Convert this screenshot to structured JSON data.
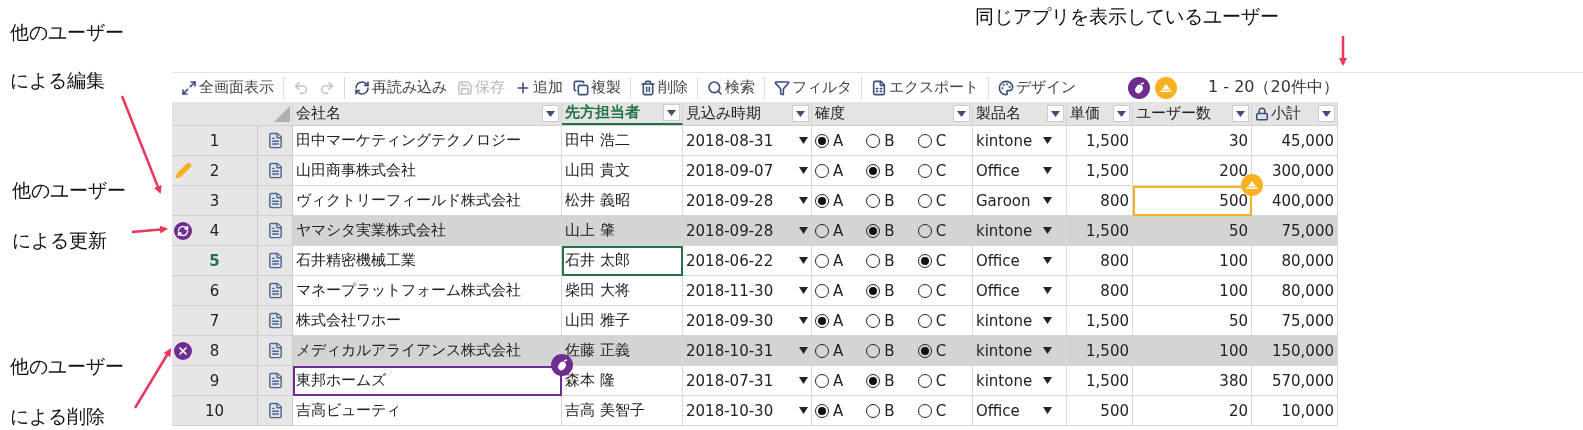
{
  "annotations": [
    {
      "lines": [
        "同じアプリを表示しているユーザー"
      ]
    },
    {
      "lines": [
        "他のユーザー",
        "による編集"
      ]
    },
    {
      "lines": [
        "他のユーザー",
        "による更新"
      ]
    },
    {
      "lines": [
        "他のユーザー",
        "による削除"
      ]
    }
  ],
  "toolbar": {
    "groups": [
      [
        {
          "kind": "fullscreen",
          "label": "全画面表示",
          "disabled": false
        }
      ],
      [
        {
          "kind": "undo",
          "disabled": true
        },
        {
          "kind": "redo",
          "disabled": true
        }
      ],
      [
        {
          "kind": "reload",
          "label": "再読み込み",
          "disabled": false
        },
        {
          "kind": "save",
          "label": "保存",
          "disabled": true
        },
        {
          "kind": "add",
          "label": "追加",
          "disabled": false
        },
        {
          "kind": "copy",
          "label": "複製",
          "disabled": false
        }
      ],
      [
        {
          "kind": "delete",
          "label": "削除",
          "disabled": false
        }
      ],
      [
        {
          "kind": "search",
          "label": "検索",
          "disabled": false
        }
      ],
      [
        {
          "kind": "filter",
          "label": "フィルタ",
          "disabled": false
        }
      ],
      [
        {
          "kind": "export",
          "label": "エクスポート",
          "disabled": false
        }
      ],
      [
        {
          "kind": "design",
          "label": "デザイン",
          "disabled": false
        }
      ]
    ],
    "viewers": [
      {
        "color": "#6f2c91"
      },
      {
        "color": "#f6b21f"
      }
    ],
    "pagination": "1 - 20（20件中）"
  },
  "columns": [
    {
      "label": "会社名",
      "selected": false,
      "locked": false
    },
    {
      "label": "先方担当者",
      "selected": true,
      "locked": false
    },
    {
      "label": "見込み時期",
      "selected": false,
      "locked": false
    },
    {
      "label": "確度",
      "selected": false,
      "locked": false
    },
    {
      "label": "製品名",
      "selected": false,
      "locked": false
    },
    {
      "label": "単価",
      "selected": false,
      "locked": false
    },
    {
      "label": "ユーザー数",
      "selected": false,
      "locked": false
    },
    {
      "label": "小計",
      "selected": false,
      "locked": true
    }
  ],
  "rows": [
    {
      "number": "1",
      "kind": "none",
      "selected": false,
      "company": "田中マーケティングテクノロジー",
      "contact": "田中 浩二",
      "date": "2018-08-31",
      "certainty": [
        {
          "label": "A",
          "selected": true
        },
        {
          "label": "B",
          "selected": false
        },
        {
          "label": "C",
          "selected": false
        }
      ],
      "product": "kintone",
      "price": "1,500",
      "users": "30",
      "subtotal": "45,000"
    },
    {
      "number": "2",
      "kind": "edited",
      "selected": false,
      "company": "山田商事株式会社",
      "contact": "山田 貴文",
      "date": "2018-09-07",
      "certainty": [
        {
          "label": "A",
          "selected": false
        },
        {
          "label": "B",
          "selected": true
        },
        {
          "label": "C",
          "selected": false
        }
      ],
      "product": "Office",
      "price": "1,500",
      "users": "200",
      "subtotal": "300,000"
    },
    {
      "number": "3",
      "kind": "none",
      "selected": false,
      "company": "ヴィクトリーフィールド株式会社",
      "contact": "松井 義昭",
      "date": "2018-09-28",
      "certainty": [
        {
          "label": "A",
          "selected": true
        },
        {
          "label": "B",
          "selected": false
        },
        {
          "label": "C",
          "selected": false
        }
      ],
      "product": "Garoon",
      "price": "800",
      "users": "500",
      "users_cursor": {
        "color": "#f6b21f"
      },
      "subtotal": "400,000"
    },
    {
      "number": "4",
      "kind": "updated",
      "selected": false,
      "company": "ヤマシタ実業株式会社",
      "contact": "山上 肇",
      "date": "2018-09-28",
      "certainty": [
        {
          "label": "A",
          "selected": false
        },
        {
          "label": "B",
          "selected": true
        },
        {
          "label": "C",
          "selected": false
        }
      ],
      "product": "kintone",
      "price": "1,500",
      "users": "50",
      "subtotal": "75,000"
    },
    {
      "number": "5",
      "kind": "none",
      "selected": true,
      "company": "石井精密機械工業",
      "contact": "石井 太郎",
      "date": "2018-06-22",
      "certainty": [
        {
          "label": "A",
          "selected": false
        },
        {
          "label": "B",
          "selected": false
        },
        {
          "label": "C",
          "selected": true
        }
      ],
      "product": "Office",
      "price": "800",
      "users": "100",
      "subtotal": "80,000"
    },
    {
      "number": "6",
      "kind": "none",
      "selected": false,
      "company": "マネープラットフォーム株式会社",
      "contact": "柴田 大将",
      "date": "2018-11-30",
      "certainty": [
        {
          "label": "A",
          "selected": false
        },
        {
          "label": "B",
          "selected": true
        },
        {
          "label": "C",
          "selected": false
        }
      ],
      "product": "Office",
      "price": "800",
      "users": "100",
      "subtotal": "80,000"
    },
    {
      "number": "7",
      "kind": "none",
      "selected": false,
      "company": "株式会社ワホー",
      "contact": "山田 雅子",
      "date": "2018-09-30",
      "certainty": [
        {
          "label": "A",
          "selected": true
        },
        {
          "label": "B",
          "selected": false
        },
        {
          "label": "C",
          "selected": false
        }
      ],
      "product": "kintone",
      "price": "1,500",
      "users": "50",
      "subtotal": "75,000"
    },
    {
      "number": "8",
      "kind": "deleted",
      "selected": false,
      "company": "メディカルアライアンス株式会社",
      "contact": "佐藤 正義",
      "date": "2018-10-31",
      "certainty": [
        {
          "label": "A",
          "selected": false
        },
        {
          "label": "B",
          "selected": false
        },
        {
          "label": "C",
          "selected": true
        }
      ],
      "product": "kintone",
      "price": "1,500",
      "users": "100",
      "subtotal": "150,000"
    },
    {
      "number": "9",
      "kind": "none",
      "selected": false,
      "company": "東邦ホームズ",
      "company_cursor": {
        "color": "#6f2c91"
      },
      "contact": "森本 隆",
      "date": "2018-07-31",
      "certainty": [
        {
          "label": "A",
          "selected": false
        },
        {
          "label": "B",
          "selected": true
        },
        {
          "label": "C",
          "selected": false
        }
      ],
      "product": "kintone",
      "price": "1,500",
      "users": "380",
      "subtotal": "570,000"
    },
    {
      "number": "10",
      "kind": "none",
      "selected": false,
      "company": "吉高ビューティ",
      "contact": "吉高 美智子",
      "date": "2018-10-30",
      "certainty": [
        {
          "label": "A",
          "selected": true
        },
        {
          "label": "B",
          "selected": false
        },
        {
          "label": "C",
          "selected": false
        }
      ],
      "product": "Office",
      "price": "500",
      "users": "20",
      "subtotal": "10,000"
    }
  ]
}
